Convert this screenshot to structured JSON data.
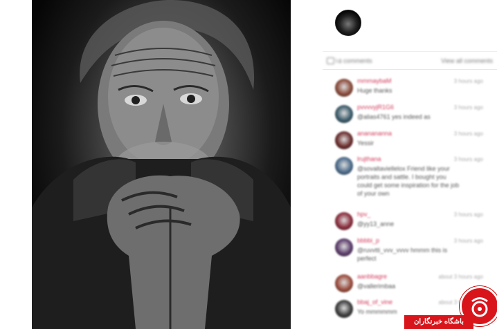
{
  "post": {
    "image_alt": "",
    "profile_avatar": "profile-avatar"
  },
  "header": {
    "comment_count": "۱۵ comments",
    "view_all": "View all comments",
    "icon": "comment-icon"
  },
  "comments": [
    {
      "user": "mmmaybaM",
      "time": "3 hours ago",
      "text": "Huge thanks",
      "avatar_color": "#8a4a3a"
    },
    {
      "user": "pvvvvyjR1G6",
      "time": "3 hours ago",
      "text": "@alias4761 yes indeed as",
      "avatar_color": "#3a5a6a"
    },
    {
      "user": "ananananna",
      "time": "3 hours ago",
      "text": "Yessir",
      "avatar_color": "#6a2a2a"
    },
    {
      "user": "lrujthana",
      "time": "3 hours ago",
      "text": "@sovaltaviellelox Friend like your portraits and sattle. I bought you could get some inspiration for the job of your own",
      "avatar_color": "#4a6a8a"
    },
    {
      "user": "hpv_",
      "time": "3 hours ago",
      "text": "@yy13_anne",
      "avatar_color": "#8a2a3a"
    },
    {
      "user": "bbbbi_p",
      "time": "3 hours ago",
      "text": "@ruvvtti_vvv_vvvv hmmm this is perfect",
      "avatar_color": "#5a3a6a"
    },
    {
      "user": "aanbbagre",
      "time": "about 3 hours ago",
      "text": "@vallerimbaa",
      "avatar_color": "#9a4a3a"
    },
    {
      "user": "bbaj_of_vine",
      "time": "about 3 hours ago",
      "text": "Yo mmmmmm",
      "avatar_color": "#3a3a3a"
    }
  ],
  "watermark": {
    "label": "باشگاه خبرنگاران",
    "color": "#d9151c"
  }
}
